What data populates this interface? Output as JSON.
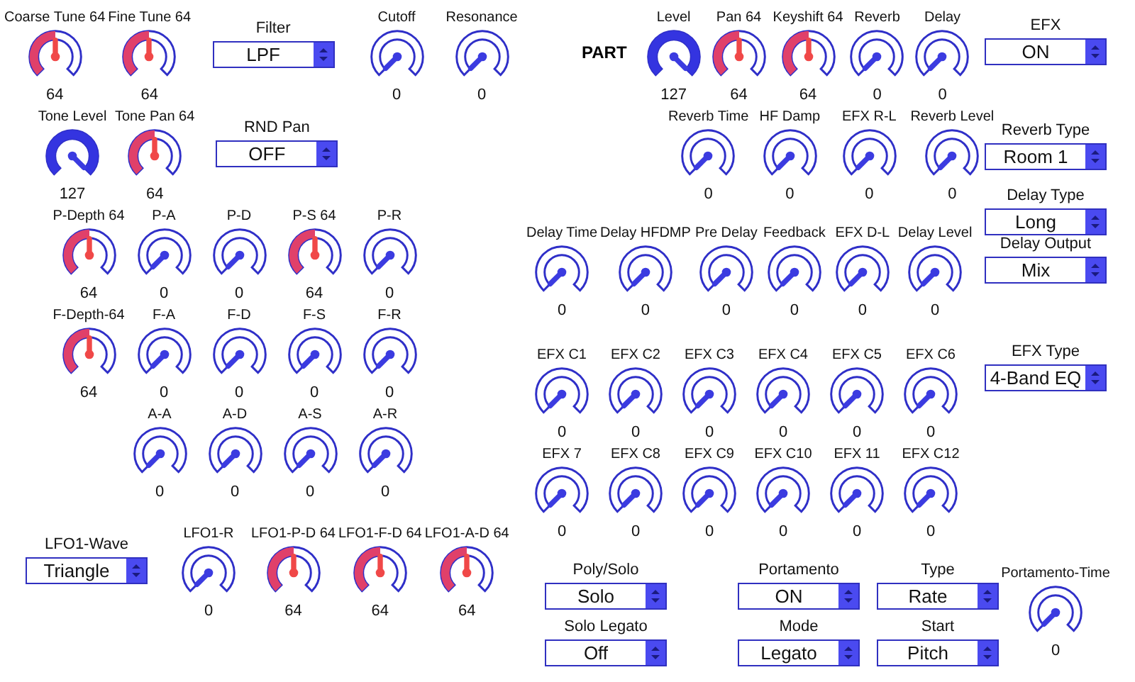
{
  "left_rows": [
    [
      {
        "kind": "center_knob",
        "label": "Coarse Tune 64",
        "value": "64",
        "level": 0.5
      },
      {
        "kind": "center_knob",
        "label": "Fine Tune 64",
        "value": "64",
        "level": 0.5
      },
      {
        "kind": "select",
        "label": "Filter",
        "value": "LPF"
      },
      {
        "kind": "knob",
        "label": "Cutoff",
        "value": "0"
      },
      {
        "kind": "knob",
        "label": "Resonance",
        "value": "0"
      }
    ],
    [
      {
        "kind": "knob",
        "label": "Tone Level",
        "value": "127",
        "level": 1
      },
      {
        "kind": "center_knob",
        "label": "Tone Pan 64",
        "value": "64",
        "level": 0.5
      },
      {
        "kind": "select",
        "label": "RND Pan",
        "value": "OFF"
      }
    ],
    [
      {
        "kind": "center_knob",
        "label": "P-Depth 64",
        "value": "64",
        "level": 0.5
      },
      {
        "kind": "knob",
        "label": "P-A",
        "value": "0"
      },
      {
        "kind": "knob",
        "label": "P-D",
        "value": "0"
      },
      {
        "kind": "center_knob",
        "label": "P-S 64",
        "value": "64",
        "level": 0.5
      },
      {
        "kind": "knob",
        "label": "P-R",
        "value": "0"
      }
    ],
    [
      {
        "kind": "center_knob",
        "label": "F-Depth-64",
        "value": "64",
        "level": 0.5
      },
      {
        "kind": "knob",
        "label": "F-A",
        "value": "0"
      },
      {
        "kind": "knob",
        "label": "F-D",
        "value": "0"
      },
      {
        "kind": "knob",
        "label": "F-S",
        "value": "0"
      },
      {
        "kind": "knob",
        "label": "F-R",
        "value": "0"
      }
    ],
    [
      {
        "kind": "knob",
        "label": "A-A",
        "value": "0"
      },
      {
        "kind": "knob",
        "label": "A-D",
        "value": "0"
      },
      {
        "kind": "knob",
        "label": "A-S",
        "value": "0"
      },
      {
        "kind": "knob",
        "label": "A-R",
        "value": "0"
      }
    ],
    [
      {
        "kind": "select",
        "label": "LFO1-Wave",
        "value": "Triangle"
      },
      {
        "kind": "knob",
        "label": "LFO1-R",
        "value": "0"
      },
      {
        "kind": "center_knob",
        "label": "LFO1-P-D 64",
        "value": "64",
        "level": 0.5
      },
      {
        "kind": "center_knob",
        "label": "LFO1-F-D 64",
        "value": "64",
        "level": 0.5
      },
      {
        "kind": "center_knob",
        "label": "LFO1-A-D 64",
        "value": "64",
        "level": 0.5
      }
    ]
  ],
  "part_label": "PART",
  "right_rows": [
    [
      {
        "kind": "knob",
        "label": "Level",
        "value": "127",
        "level": 1
      },
      {
        "kind": "center_knob",
        "label": "Pan 64",
        "value": "64",
        "level": 0.5
      },
      {
        "kind": "center_knob",
        "label": "Keyshift 64",
        "value": "64",
        "level": 0.5
      },
      {
        "kind": "knob",
        "label": "Reverb",
        "value": "0"
      },
      {
        "kind": "knob",
        "label": "Delay",
        "value": "0"
      }
    ],
    [
      {
        "kind": "knob",
        "label": "Reverb Time",
        "value": "0"
      },
      {
        "kind": "knob",
        "label": "HF Damp",
        "value": "0"
      },
      {
        "kind": "knob",
        "label": "EFX R-L",
        "value": "0"
      },
      {
        "kind": "knob",
        "label": "Reverb Level",
        "value": "0"
      }
    ],
    [
      {
        "kind": "knob",
        "label": "Delay Time",
        "value": "0"
      },
      {
        "kind": "knob",
        "label": "Delay HFDMP",
        "value": "0"
      },
      {
        "kind": "knob",
        "label": "Pre Delay",
        "value": "0"
      },
      {
        "kind": "knob",
        "label": "Feedback",
        "value": "0"
      },
      {
        "kind": "knob",
        "label": "EFX D-L",
        "value": "0"
      },
      {
        "kind": "knob",
        "label": "Delay Level",
        "value": "0"
      }
    ],
    [
      {
        "kind": "knob",
        "label": "EFX C1",
        "value": "0"
      },
      {
        "kind": "knob",
        "label": "EFX C2",
        "value": "0"
      },
      {
        "kind": "knob",
        "label": "EFX C3",
        "value": "0"
      },
      {
        "kind": "knob",
        "label": "EFX C4",
        "value": "0"
      },
      {
        "kind": "knob",
        "label": "EFX C5",
        "value": "0"
      },
      {
        "kind": "knob",
        "label": "EFX C6",
        "value": "0"
      }
    ],
    [
      {
        "kind": "knob",
        "label": "EFX 7",
        "value": "0"
      },
      {
        "kind": "knob",
        "label": "EFX C8",
        "value": "0"
      },
      {
        "kind": "knob",
        "label": "EFX C9",
        "value": "0"
      },
      {
        "kind": "knob",
        "label": "EFX C10",
        "value": "0"
      },
      {
        "kind": "knob",
        "label": "EFX 11",
        "value": "0"
      },
      {
        "kind": "knob",
        "label": "EFX C12",
        "value": "0"
      }
    ]
  ],
  "right_selects": [
    {
      "label": "EFX",
      "value": "ON"
    },
    {
      "label": "Reverb Type",
      "value": "Room 1"
    },
    {
      "label": "Delay Type",
      "value": "Long"
    },
    {
      "label": "Delay Output",
      "value": "Mix"
    },
    {
      "label": "EFX Type",
      "value": "4-Band EQ"
    }
  ],
  "bottom_selects": [
    {
      "label": "Poly/Solo",
      "value": "Solo"
    },
    {
      "label": "Portamento",
      "value": "ON"
    },
    {
      "label": "Type",
      "value": "Rate"
    },
    {
      "label": "Solo Legato",
      "value": "Off"
    },
    {
      "label": "Mode",
      "value": "Legato"
    },
    {
      "label": "Start",
      "value": "Pitch"
    }
  ],
  "portamento_time": {
    "kind": "knob",
    "label": "Portamento-Time",
    "value": "0"
  }
}
